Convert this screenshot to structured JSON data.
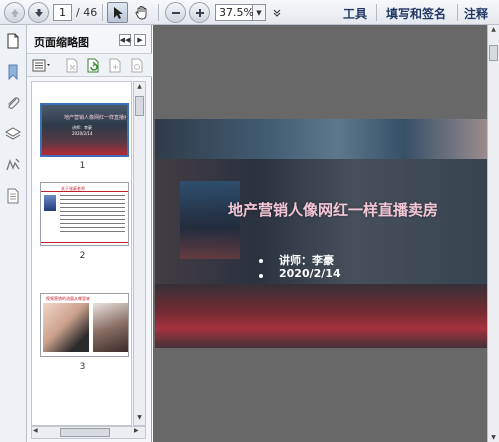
{
  "toolbar": {
    "current_page": "1",
    "total_pages": "/ 46",
    "zoom": "37.5%",
    "tools_label": "工具",
    "fill_sign_label": "填写和签名",
    "comment_label": "注释"
  },
  "panel": {
    "title": "页面缩略图"
  },
  "thumbnails": [
    {
      "number": "1",
      "title": "地产营销人像网红一样直播卖房"
    },
    {
      "number": "2",
      "title": "关于张豪老师"
    },
    {
      "number": "3",
      "title": "视频营销的流量从哪里来"
    }
  ],
  "slide": {
    "title": "地产营销人像网红一样直播卖房",
    "lecturer": "讲师：李豪",
    "date": "2020/2/14"
  },
  "colors": {
    "doc_background": "#686868",
    "slide_title": "#f4c5d5",
    "toolbar_text": "#233a66"
  }
}
